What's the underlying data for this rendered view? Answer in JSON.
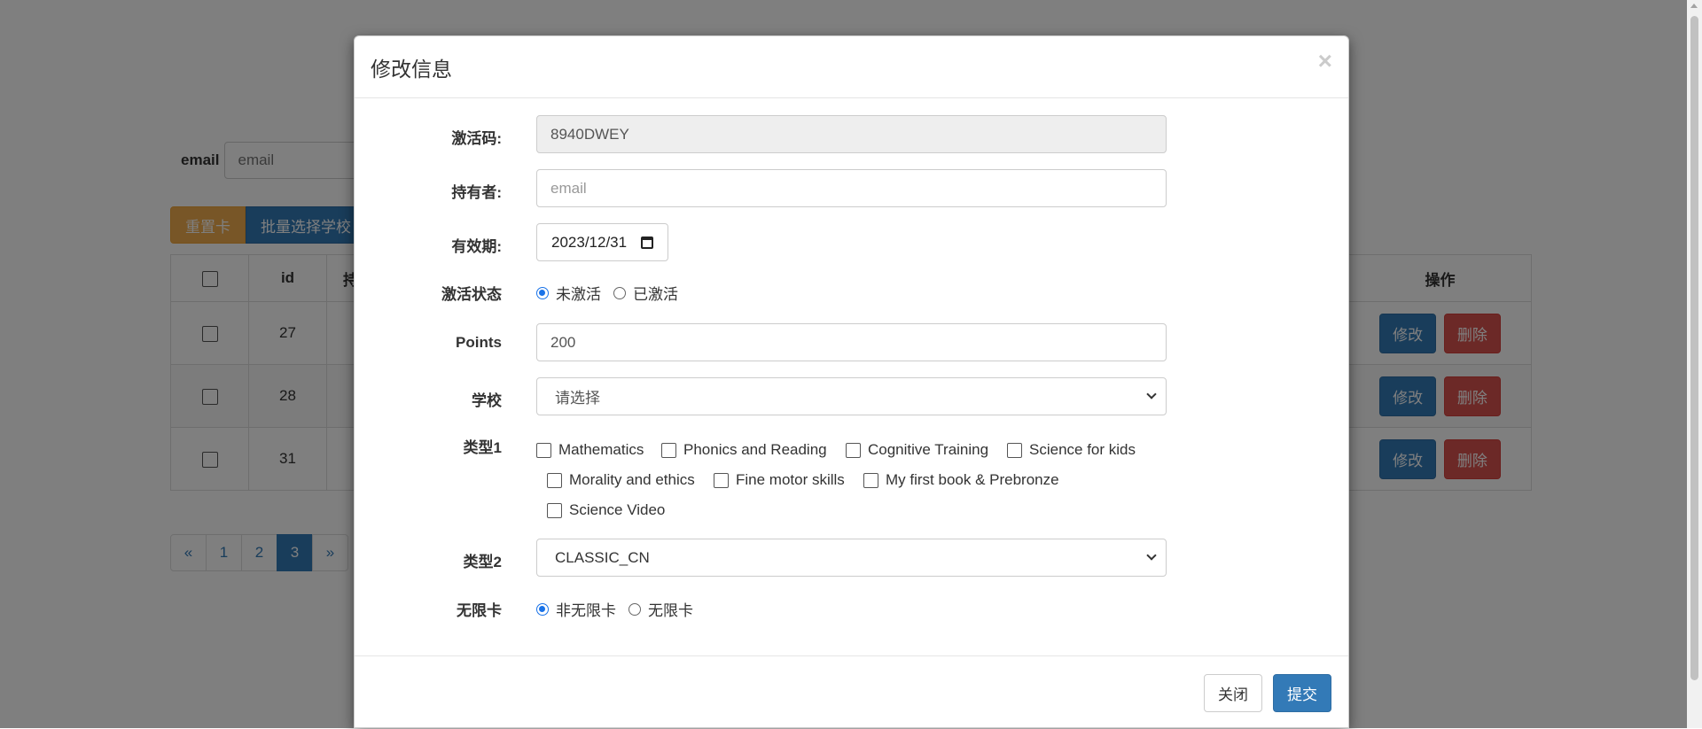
{
  "background": {
    "filter": {
      "label": "email",
      "placeholder": "email"
    },
    "buttons": {
      "reset": "重置卡",
      "batch_school": "批量选择学校"
    },
    "table": {
      "headers": {
        "id": "id",
        "holder": "持",
        "actions": "操作"
      },
      "rows": [
        {
          "id": "27"
        },
        {
          "id": "28"
        },
        {
          "id": "31"
        }
      ],
      "edit_label": "修改",
      "delete_label": "删除"
    },
    "pagination": {
      "prev": "«",
      "pages": [
        "1",
        "2",
        "3"
      ],
      "active": "3",
      "next": "»"
    }
  },
  "modal": {
    "title": "修改信息",
    "close_symbol": "×",
    "fields": {
      "activation_code": {
        "label": "激活码:",
        "value": "8940DWEY"
      },
      "holder": {
        "label": "持有者:",
        "placeholder": "email"
      },
      "expiry": {
        "label": "有效期:",
        "value": "2023/12/31"
      },
      "status": {
        "label": "激活状态",
        "options": [
          "未激活",
          "已激活"
        ],
        "selected": "未激活"
      },
      "points": {
        "label": "Points",
        "value": "200"
      },
      "school": {
        "label": "学校",
        "selected": "请选择"
      },
      "type1": {
        "label": "类型1",
        "options": [
          "Mathematics",
          "Phonics and Reading",
          "Cognitive Training",
          "Science for kids",
          "Morality and ethics",
          "Fine motor skills",
          "My first book & Prebronze",
          "Science Video"
        ]
      },
      "type2": {
        "label": "类型2",
        "selected": "CLASSIC_CN"
      },
      "unlimited": {
        "label": "无限卡",
        "options": [
          "非无限卡",
          "无限卡"
        ],
        "selected": "非无限卡"
      }
    },
    "footer": {
      "close": "关闭",
      "submit": "提交"
    }
  },
  "colors": {
    "primary": "#337ab7",
    "danger": "#d9534f",
    "warning": "#f0ad4e",
    "radio_accent": "#1a73e8"
  }
}
